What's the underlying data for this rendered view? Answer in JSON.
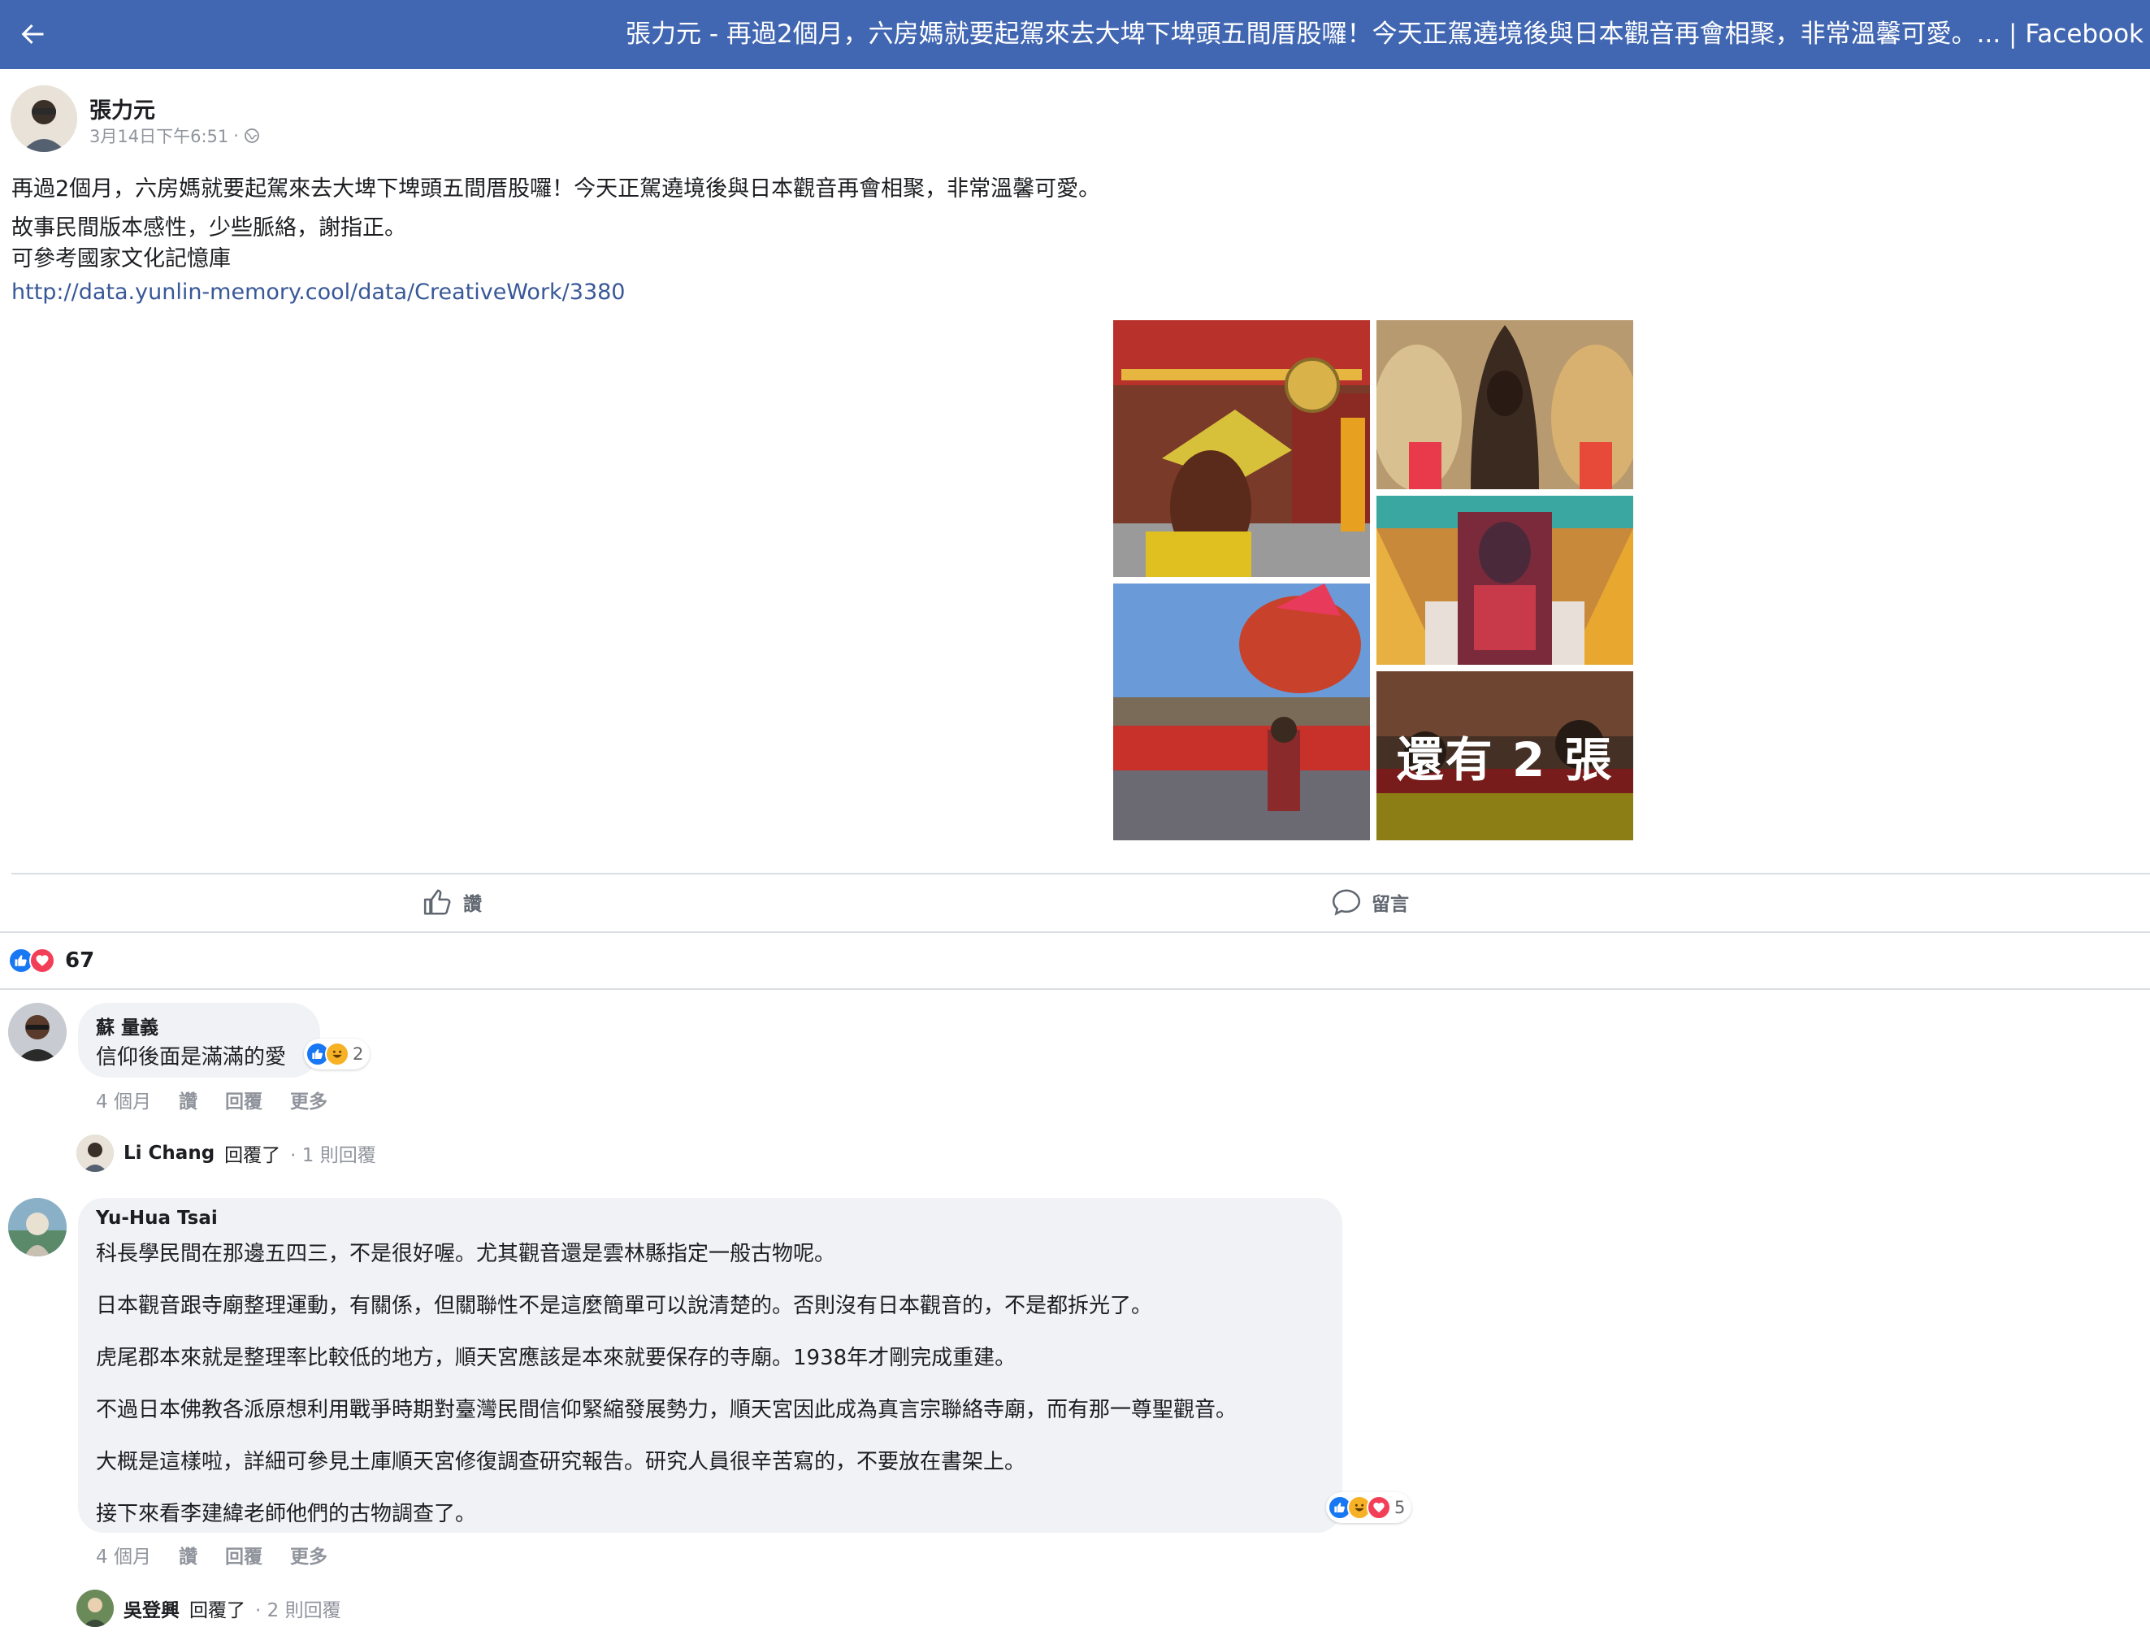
{
  "topbar": {
    "title": "張力元 - 再過2個月，六房媽就要起駕來去大埤下埤頭五間厝股囉！今天正駕遶境後與日本觀音再會相聚，非常溫馨可愛。... | Facebook"
  },
  "post": {
    "author": "張力元",
    "timestamp": "3月14日下午6:51",
    "separator": "·",
    "privacy_icon": "globe-icon",
    "lines": [
      "再過2個月，六房媽就要起駕來去大埤下埤頭五間厝股囉！今天正駕遶境後與日本觀音再會相聚，非常溫馨可愛。",
      "故事民間版本感性，少些脈絡，謝指正。",
      "可參考國家文化記憶庫"
    ],
    "link": "http://data.yunlin-memory.cool/data/CreativeWork/3380",
    "more_photos_label": "還有 2 張"
  },
  "actions": {
    "like_label": "讚",
    "comment_label": "留言"
  },
  "reactions": {
    "icons": [
      "like-icon",
      "love-icon"
    ],
    "count": "67"
  },
  "comments": [
    {
      "name": "蘇 量義",
      "text": [
        "信仰後面是滿滿的愛"
      ],
      "reaction_count": "2",
      "time": "4 個月",
      "like": "讚",
      "reply": "回覆",
      "more": "更多"
    },
    {
      "name": "Yu-Hua Tsai",
      "text": [
        "科長學民間在那邊五四三，不是很好喔。尤其觀音還是雲林縣指定一般古物呢。",
        "日本觀音跟寺廟整理運動，有關係，但關聯性不是這麼簡單可以說清楚的。否則沒有日本觀音的，不是都拆光了。",
        "虎尾郡本來就是整理率比較低的地方，順天宮應該是本來就要保存的寺廟。1938年才剛完成重建。",
        "不過日本佛教各派原想利用戰爭時期對臺灣民間信仰緊縮發展勢力，順天宮因此成為真言宗聯絡寺廟，而有那一尊聖觀音。",
        "大概是這樣啦，詳細可參見土庫順天宮修復調查研究報告。研究人員很辛苦寫的，不要放在書架上。",
        "接下來看李建緯老師他們的古物調查了。"
      ],
      "reaction_count": "5",
      "time": "4 個月",
      "like": "讚",
      "reply": "回覆",
      "more": "更多"
    }
  ],
  "replies": [
    {
      "name": "Li Chang",
      "suffix": "回覆了",
      "count": "· 1 則回覆"
    },
    {
      "name": "吳登興",
      "suffix": "回覆了",
      "count": "· 2 則回覆"
    }
  ],
  "colors": {
    "topbar": "#4267b2",
    "link": "#385898",
    "like_blue": "#1877f2",
    "love_red": "#f33e58",
    "haha_yellow": "#f7b125",
    "bubble": "#f0f2f5",
    "muted": "#90949c"
  }
}
